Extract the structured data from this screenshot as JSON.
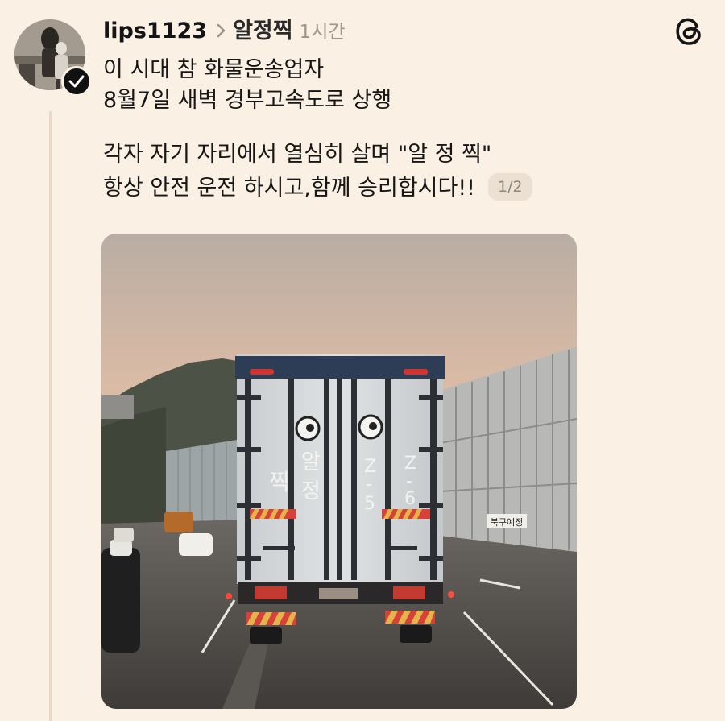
{
  "post": {
    "username": "lips1123",
    "topic": "알정찍",
    "time": "1시간",
    "lines": [
      "이 시대 참 화물운송업자",
      "8월7일 새벽 경부고속도로 상행",
      "각자 자기 자리에서 열심히 살며 \"알 정 찍\"",
      "항상 안전 운전 하시고,함께 승리합시다!!"
    ],
    "page_indicator": "1/2"
  },
  "photo": {
    "truck_text": {
      "left_col": "찍",
      "mid_col": [
        "알",
        "정"
      ],
      "col3": [
        "Z",
        "-",
        "5"
      ],
      "col4": [
        "Z",
        "-",
        "6"
      ]
    },
    "road_sign": "북구예정"
  },
  "icons": {
    "verified": "check-circle-icon",
    "threads_logo": "threads-logo-icon",
    "chevron": "chevron-right-icon"
  },
  "colors": {
    "background": "#fbf0e4",
    "text": "#161616",
    "muted": "#9e978d"
  }
}
